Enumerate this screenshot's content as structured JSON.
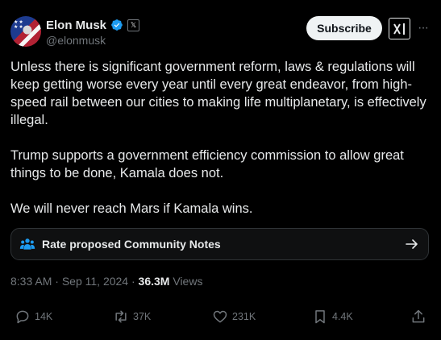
{
  "author": {
    "name": "Elon Musk",
    "handle": "@elonmusk",
    "affiliate_badge": "𝕏"
  },
  "header": {
    "subscribe_label": "Subscribe",
    "more_label": "···"
  },
  "tweet": {
    "paragraphs": [
      "Unless there is significant government reform, laws & regulations will keep getting worse every year until every great endeavor, from high-speed rail between our cities to making life multiplanetary, is effectively illegal.",
      "Trump supports a government efficiency commission to allow great things to be done, Kamala does not.",
      "We will never reach Mars if Kamala wins."
    ]
  },
  "community_notes": {
    "label": "Rate proposed Community Notes"
  },
  "meta": {
    "time": "8:33 AM",
    "separator": " · ",
    "date": "Sep 11, 2024",
    "views_count": "36.3M",
    "views_label": " Views"
  },
  "actions": {
    "replies": "14K",
    "reposts": "37K",
    "likes": "231K",
    "bookmarks": "4.4K"
  },
  "colors": {
    "background": "#000000",
    "text": "#e7e9ea",
    "muted": "#71767b",
    "verified": "#1d9bf0",
    "notes_icon": "#1d9bf0"
  }
}
